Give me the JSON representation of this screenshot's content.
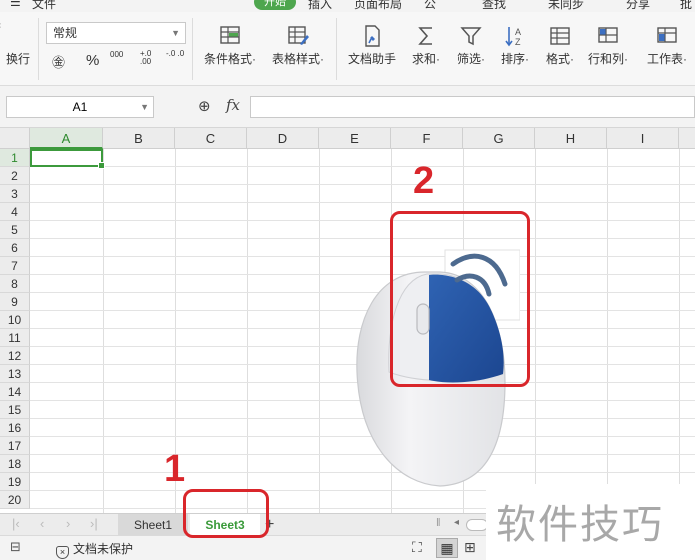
{
  "menubar": {
    "items": [
      "文件",
      "开始",
      "插入",
      "页面布局",
      "公",
      "查找",
      "未同步",
      "分享",
      "批"
    ],
    "active": "开始"
  },
  "ribbon": {
    "wrap_label": "换行",
    "number_format": "常规",
    "currency_symbol": "¥",
    "percent_symbol": "%",
    "thousands_symbol": "000",
    "inc_decimal": "+.0 .00",
    "dec_decimal": "-.0 .0",
    "buttons": [
      {
        "label": "条件格式·",
        "icon": "conditional-format-icon"
      },
      {
        "label": "表格样式·",
        "icon": "table-style-icon"
      },
      {
        "label": "文档助手",
        "icon": "doc-assistant-icon"
      },
      {
        "label": "求和·",
        "icon": "sum-icon"
      },
      {
        "label": "筛选·",
        "icon": "filter-icon"
      },
      {
        "label": "排序·",
        "icon": "sort-icon"
      },
      {
        "label": "格式·",
        "icon": "format-icon"
      },
      {
        "label": "行和列·",
        "icon": "rows-cols-icon"
      },
      {
        "label": "工作表·",
        "icon": "worksheet-icon"
      }
    ]
  },
  "formula_bar": {
    "name_box": "A1",
    "fx_label": "fx",
    "formula": ""
  },
  "grid": {
    "columns": [
      "A",
      "B",
      "C",
      "D",
      "E",
      "F",
      "G",
      "H",
      "I"
    ],
    "rows": [
      "1",
      "2",
      "3",
      "4",
      "5",
      "6",
      "7",
      "8",
      "9",
      "10",
      "11",
      "12",
      "13",
      "14",
      "15",
      "16",
      "17",
      "18",
      "19",
      "20"
    ],
    "active_cell": "A1"
  },
  "sheets": {
    "tabs": [
      "Sheet1",
      "Sheet3"
    ],
    "active": "Sheet3",
    "add": "+"
  },
  "status": {
    "protect_label": "文档未保护"
  },
  "annotations": {
    "label_1": "1",
    "label_2": "2",
    "color": "#d9262b"
  },
  "watermark": "软件技巧",
  "colors": {
    "accent_green": "#3c9a3c",
    "mouse_button_blue": "#2454a0"
  }
}
